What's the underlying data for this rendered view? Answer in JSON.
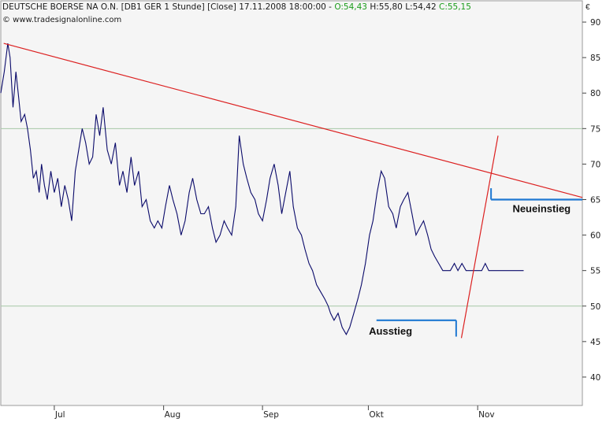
{
  "header": {
    "instrument": "DEUTSCHE BOERSE NA O.N. [DB1 GER  1 Stunde] [Close] 17.11.2008 18:00:00 - ",
    "open_label": "O:54,43",
    "high_label": "H:55,80",
    "low_label": "L:54,42",
    "close_label": "C:55,15",
    "copyright": "© www.tradesignalonline.com",
    "currency": "€"
  },
  "chart_data": {
    "type": "line",
    "title": "DEUTSCHE BOERSE NA O.N. [DB1 GER  1 Stunde] [Close] 17.11.2008 18:00:00",
    "x_tick_labels": [
      "Jul",
      "Aug",
      "Sep",
      "Okt",
      "Nov"
    ],
    "y_ticks": [
      40,
      45,
      50,
      55,
      60,
      65,
      70,
      75,
      80,
      85,
      90
    ],
    "ylim": [
      36,
      93
    ],
    "xlim": [
      0,
      100
    ],
    "x_ticks": [
      9.2,
      28.0,
      45.0,
      63.2,
      82.0
    ],
    "reference_lines": [
      50,
      75
    ],
    "grid": false,
    "series": [
      {
        "values_x": [
          0,
          0.6,
          1.2,
          1.6,
          2.1,
          2.6,
          3.0,
          3.5,
          4.1,
          4.6,
          5.1,
          5.6,
          6.1,
          6.6,
          7.0,
          7.5,
          8.0,
          8.6,
          9.2,
          9.8,
          10.4,
          11.0,
          11.6,
          12.2,
          12.8,
          13.4,
          14.0,
          14.6,
          15.2,
          15.8,
          16.4,
          17.0,
          17.6,
          18.3,
          19.0,
          19.7,
          20.4,
          21.0,
          21.7,
          22.4,
          23.0,
          23.7,
          24.3,
          25.0,
          25.7,
          26.4,
          27.0,
          27.7,
          28.3,
          29.0,
          29.6,
          30.3,
          31.0,
          31.7,
          32.4,
          33.0,
          33.7,
          34.4,
          35.0,
          35.7,
          36.4,
          37.0,
          37.7,
          38.4,
          39.0,
          39.7,
          40.4,
          41.0,
          41.7,
          42.3,
          43.0,
          43.7,
          44.3,
          45.0,
          45.7,
          46.3,
          47.0,
          47.7,
          48.3,
          49.0,
          49.7,
          50.3,
          51.0,
          51.7,
          52.3,
          53.0,
          53.6,
          54.3,
          55.0,
          55.7,
          56.3,
          56.7,
          57.3,
          58.0,
          58.7,
          59.4,
          60.0,
          60.7,
          61.4,
          62.0,
          62.7,
          63.4,
          64.0,
          64.7,
          65.4,
          66.0,
          66.7,
          67.4,
          68.0,
          68.7,
          69.3,
          70.0,
          70.7,
          71.4,
          72.0,
          72.7,
          73.4,
          74.0,
          74.6,
          75.3,
          76.0,
          76.7,
          77.3,
          78.0,
          78.6,
          79.3,
          80.0,
          80.7,
          81.4,
          82.1,
          82.7,
          83.3,
          83.9,
          84.5,
          85.1,
          85.7,
          86.3,
          86.9,
          87.5,
          88.1,
          88.7,
          89.3,
          89.9,
          90.5
        ],
        "values": [
          80,
          83,
          87,
          85,
          78,
          83,
          80,
          76,
          77,
          75,
          72,
          68,
          69,
          66,
          70,
          67,
          65,
          69,
          66,
          68,
          64,
          67,
          65,
          62,
          69,
          72,
          75,
          73,
          70,
          71,
          77,
          74,
          78,
          72,
          70,
          73,
          67,
          69,
          66,
          71,
          67,
          69,
          64,
          65,
          62,
          61,
          62,
          61,
          64,
          67,
          65,
          63,
          60,
          62,
          66,
          68,
          65,
          63,
          63,
          64,
          61,
          59,
          60,
          62,
          61,
          60,
          64,
          74,
          70,
          68,
          66,
          65,
          63,
          62,
          65,
          68,
          70,
          67,
          63,
          66,
          69,
          64,
          61,
          60,
          58,
          56,
          55,
          53,
          52,
          51,
          50,
          49,
          48,
          49,
          47,
          46,
          47,
          49,
          51,
          53,
          56,
          60,
          62,
          66,
          69,
          68,
          64,
          63,
          61,
          64,
          65,
          66,
          63,
          60,
          61,
          62,
          60,
          58,
          57,
          56,
          55,
          55,
          55,
          56,
          55,
          56,
          55,
          55,
          55,
          55,
          55,
          56,
          55,
          55,
          55,
          55,
          55,
          55,
          55,
          55,
          55,
          55,
          55
        ]
      }
    ],
    "annotations": [
      {
        "label": "Ausstieg",
        "value": 48
      },
      {
        "label": "Neueinstieg",
        "value": 65
      }
    ],
    "trendlines": [
      {
        "from": [
          0.5,
          87
        ],
        "to": [
          100,
          65.3
        ]
      },
      {
        "from": [
          79.2,
          45.5
        ],
        "to": [
          85.5,
          74
        ]
      }
    ],
    "colors": {
      "price": "#0a0a6a",
      "trendline": "#dc2020",
      "signal": "#1e78d2",
      "refline": "#a6c8a6",
      "plot_bg": "#f5f5f5"
    }
  }
}
